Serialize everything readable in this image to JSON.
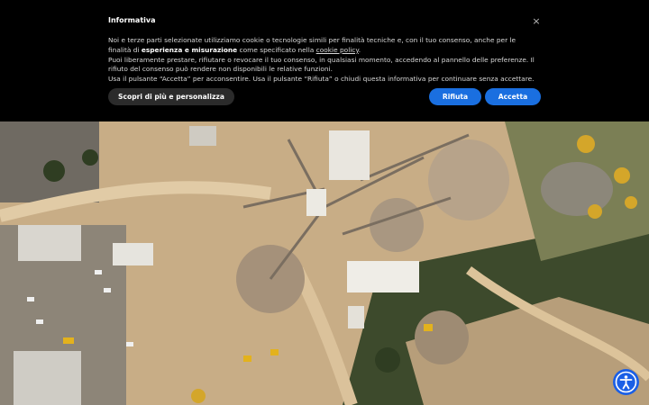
{
  "banner": {
    "title": "Informativa",
    "close_symbol": "×",
    "line1_a": "Noi e terze parti selezionate utilizziamo cookie o tecnologie simili per finalità tecniche e, con il tuo consenso, anche per le finalità di ",
    "line1_bold": "esperienza e misurazione",
    "line1_b": " come specificato nella ",
    "cookie_link": "cookie policy",
    "line1_c": ".",
    "line2": "Puoi liberamente prestare, rifiutare o revocare il tuo consenso, in qualsiasi momento, accedendo al pannello delle preferenze. Il rifiuto del consenso può rendere non disponibili le relative funzioni.",
    "line3": "Usa il pulsante “Accetta” per acconsentire. Usa il pulsante “Rifiuta” o chiudi questa informativa per continuare senza accettare.",
    "more_label": "Scopri di più e personalizza",
    "reject_label": "Rifiuta",
    "accept_label": "Accetta"
  },
  "colors": {
    "button_blue": "#1a6fe0",
    "banner_bg": "#000000"
  },
  "icons": {
    "close": "close-icon",
    "accessibility": "accessibility-icon"
  }
}
